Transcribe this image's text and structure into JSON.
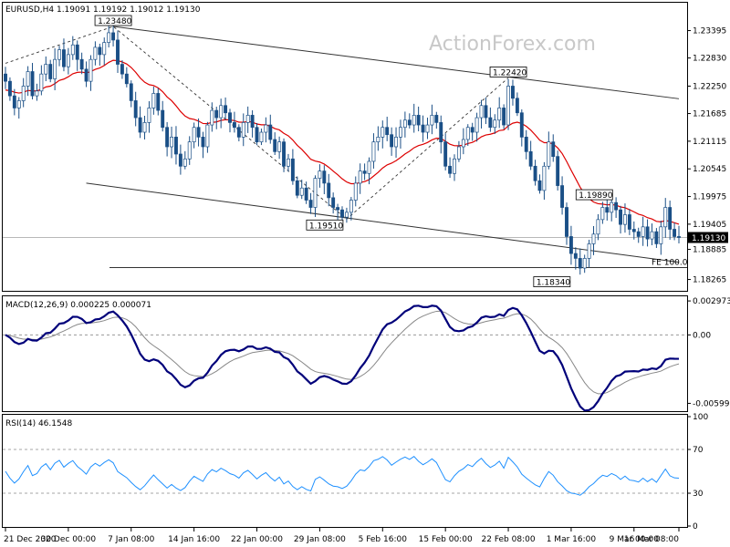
{
  "chart_data": [
    {
      "type": "candlestick",
      "panel": "price",
      "header": "EURUSD,H4  1.19091 1.19192 1.19012 1.19130",
      "watermark": "ActionForex.com",
      "ylim": [
        1.1805,
        1.2395
      ],
      "y_ticks": [
        "1.23395",
        "1.22830",
        "1.22250",
        "1.21685",
        "1.21115",
        "1.20545",
        "1.19975",
        "1.19405",
        "1.18885",
        "1.18265"
      ],
      "y_tick_values": [
        1.23395,
        1.2283,
        1.2225,
        1.21685,
        1.21115,
        1.20545,
        1.19975,
        1.19405,
        1.18885,
        1.18265
      ],
      "current_price": {
        "label": "1.19130",
        "value": 1.1913
      },
      "labels": [
        {
          "text": "1.23480",
          "bar": 24,
          "value": 1.2348
        },
        {
          "text": "1.22420",
          "bar": 112,
          "value": 1.2242
        },
        {
          "text": "1.19510",
          "bar": 76,
          "value": 1.1951
        },
        {
          "text": "1.19890",
          "bar": 134,
          "value": 1.1989
        },
        {
          "text": "1.18340",
          "bar": 127,
          "value": 1.1834
        }
      ],
      "fib_label": "FE 100.0",
      "fib_level": 1.1851,
      "channel_upper": [
        {
          "bar": 24,
          "value": 1.2348
        },
        {
          "bar": 150,
          "value": 1.2199
        }
      ],
      "channel_lower": [
        {
          "bar": 18,
          "value": 1.2025
        },
        {
          "bar": 150,
          "value": 1.1862
        }
      ],
      "swing_lines": [
        [
          {
            "bar": 0,
            "value": 1.2272
          },
          {
            "bar": 24,
            "value": 1.2348
          },
          {
            "bar": 76,
            "value": 1.1951
          },
          {
            "bar": 112,
            "value": 1.2242
          }
        ]
      ],
      "moving_average_color": "#dd0000",
      "price_color": "#1a4f86",
      "closes": [
        1.2235,
        1.2205,
        1.218,
        1.2195,
        1.2225,
        1.2255,
        1.2205,
        1.2215,
        1.225,
        1.227,
        1.224,
        1.228,
        1.23,
        1.2265,
        1.229,
        1.231,
        1.228,
        1.226,
        1.2235,
        1.228,
        1.2305,
        1.229,
        1.2315,
        1.2335,
        1.232,
        1.227,
        1.225,
        1.223,
        1.2195,
        1.216,
        1.213,
        1.215,
        1.218,
        1.221,
        1.2175,
        1.214,
        1.21,
        1.212,
        1.2085,
        1.206,
        1.2075,
        1.211,
        1.214,
        1.212,
        1.21,
        1.2145,
        1.2175,
        1.216,
        1.2185,
        1.217,
        1.215,
        1.214,
        1.212,
        1.215,
        1.2165,
        1.214,
        1.211,
        1.213,
        1.2145,
        1.2115,
        1.209,
        1.211,
        1.206,
        1.2075,
        1.203,
        1.2,
        1.2015,
        1.199,
        1.1975,
        1.2035,
        1.205,
        1.2025,
        1.1995,
        1.1975,
        1.197,
        1.1955,
        1.1965,
        1.199,
        1.2025,
        1.205,
        1.2045,
        1.207,
        1.211,
        1.212,
        1.214,
        1.2125,
        1.21,
        1.212,
        1.214,
        1.2155,
        1.2145,
        1.2165,
        1.2145,
        1.213,
        1.2145,
        1.2165,
        1.215,
        1.211,
        1.206,
        1.2045,
        1.2075,
        1.21,
        1.2115,
        1.214,
        1.213,
        1.216,
        1.2185,
        1.216,
        1.214,
        1.2155,
        1.218,
        1.2145,
        1.2225,
        1.22,
        1.217,
        1.212,
        1.209,
        1.206,
        1.203,
        1.201,
        1.206,
        1.211,
        1.208,
        1.202,
        1.1975,
        1.1915,
        1.188,
        1.187,
        1.185,
        1.187,
        1.19,
        1.192,
        1.195,
        1.1975,
        1.1965,
        1.1985,
        1.197,
        1.194,
        1.196,
        1.193,
        1.1925,
        1.1915,
        1.1935,
        1.191,
        1.1925,
        1.19,
        1.1935,
        1.1975,
        1.193,
        1.1915,
        1.1913
      ],
      "ma_period": 20,
      "ma_seed": 1.2215,
      "x_ticks": [
        "21 Dec 2020",
        "30 Dec 00:00",
        "7 Jan 08:00",
        "14 Jan 16:00",
        "22 Jan 00:00",
        "29 Jan 08:00",
        "5 Feb 16:00",
        "15 Feb 00:00",
        "22 Feb 08:00",
        "1 Mar 16:00",
        "9 Mar 00:00",
        "16 Mar 08:00"
      ],
      "x_tick_bars": [
        0,
        14,
        28,
        42,
        56,
        70,
        84,
        98,
        112,
        126,
        140,
        150
      ]
    },
    {
      "type": "line",
      "panel": "macd",
      "header": "MACD(12,26,9) 0.000225 0.000071",
      "ylim": [
        -0.0066,
        0.0033
      ],
      "y_ticks": [
        "0.002973",
        "0.00",
        "-0.005996"
      ],
      "y_tick_values": [
        0.002973,
        0,
        -0.005996
      ],
      "series": [
        {
          "key": "macd",
          "color": "#00007a"
        },
        {
          "key": "signal",
          "color": "#888888"
        }
      ]
    },
    {
      "type": "line",
      "panel": "rsi",
      "header": "RSI(14) 46.1548",
      "ylim": [
        0,
        100
      ],
      "y_ticks": [
        "100",
        "70",
        "30",
        "0"
      ],
      "y_tick_values": [
        100,
        70,
        30,
        0
      ],
      "levels": [
        70,
        30
      ],
      "series": [
        {
          "key": "rsi",
          "color": "#1e90ff"
        }
      ]
    }
  ]
}
